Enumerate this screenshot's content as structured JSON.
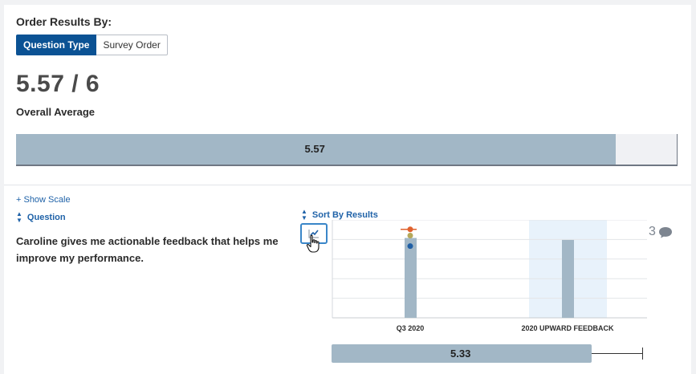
{
  "order_results": {
    "label": "Order Results By:",
    "buttons": [
      {
        "label": "Question Type",
        "active": true
      },
      {
        "label": "Survey Order",
        "active": false
      }
    ]
  },
  "summary": {
    "score_text": "5.57 / 6",
    "score": 5.57,
    "max": 6,
    "label": "Overall Average",
    "bar_value_text": "5.57"
  },
  "controls": {
    "show_scale": "+ Show Scale",
    "question_header": "Question",
    "sort_header": "Sort By Results"
  },
  "question": {
    "text": "Caroline gives me actionable feedback that helps me improve my performance.",
    "comment_count": "3",
    "average_text": "5.33",
    "average": 5.33
  },
  "chart_data": {
    "type": "bar",
    "categories": [
      "Q3 2020",
      "2020 UPWARD FEEDBACK"
    ],
    "values": [
      5.33,
      5.2
    ],
    "ylim": [
      0,
      6
    ],
    "grid": true,
    "markers": [
      {
        "category": "Q3 2020",
        "value": 5.8,
        "color": "#e0622e"
      },
      {
        "category": "Q3 2020",
        "value": 5.6,
        "color": "#b5a85a"
      },
      {
        "category": "Q3 2020",
        "value": 5.0,
        "color": "#1f5fa5"
      }
    ],
    "highlight_category": "2020 UPWARD FEEDBACK",
    "bar_color": "#a2b7c6",
    "highlight_color": "#e8f2fb"
  },
  "colors": {
    "primary": "#0b5294",
    "link": "#1f62a8",
    "bar": "#a2b7c6"
  },
  "icons": {
    "trend": "line-chart-icon",
    "comment": "speech-bubble-icon",
    "sort": "sort-arrows-icon",
    "cursor": "hand-pointer-icon"
  }
}
